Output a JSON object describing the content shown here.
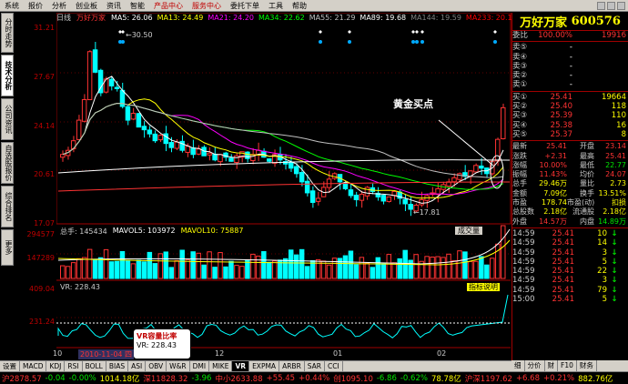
{
  "menubar": {
    "items": [
      "系统",
      "报价",
      "分析",
      "创业板",
      "资讯",
      "智能",
      "产品中心",
      "服务中心",
      "委托下单",
      "工具",
      "帮助"
    ],
    "highlight": [
      false,
      false,
      false,
      false,
      false,
      false,
      true,
      true,
      false,
      false,
      false
    ]
  },
  "left_tabs": [
    "分时走势",
    "技术分析",
    "公司资讯",
    "自选股报价",
    "综合排名",
    "更多"
  ],
  "active_left_tab": "技术分析",
  "kline": {
    "period": "日线",
    "stock": "万好万家",
    "ma_labels": [
      {
        "text": "MA5: 26.06",
        "color": "#ffffff"
      },
      {
        "text": "MA13: 24.49",
        "color": "#ffff00"
      },
      {
        "text": "MA21: 24.20",
        "color": "#ff00ff"
      },
      {
        "text": "MA34: 22.62",
        "color": "#00ff00"
      },
      {
        "text": "MA55: 21.29",
        "color": "#c0c0c0"
      },
      {
        "text": "MA89: 19.68",
        "color": "#ffffff"
      },
      {
        "text": "MA144: 19.59",
        "color": "#808080"
      },
      {
        "text": "MA233: 20.14",
        "color": "#ff0000"
      }
    ],
    "price_axis": [
      "31.21",
      "27.67",
      "24.14",
      "20.61",
      "17.07"
    ],
    "high_label": "30.50",
    "low_label": "17.81",
    "annotation": "黄金买点"
  },
  "volume": {
    "total_label": "总手: 145434",
    "mavol5_label": "MAVOL5: 103972",
    "mavol10_label": "MAVOL10: 75887",
    "axis": [
      "294577",
      "147289"
    ],
    "badge": "成交量"
  },
  "vr": {
    "label": "VR: 228.43",
    "axis": [
      "409.04",
      "231.24"
    ],
    "badge": "指标说明"
  },
  "date_axis": {
    "labels": [
      "10",
      "2010-11-04 四",
      "12",
      "01",
      "02"
    ]
  },
  "tooltip": {
    "title": "VR容量比率",
    "value": "VR: 228.43"
  },
  "quote": {
    "name": "万好万家",
    "code": "600576",
    "weibi_label": "委比",
    "weibi_value": "100.00%",
    "weicha_value": "19916",
    "sell": [
      {
        "label": "卖⑤",
        "price": "-",
        "vol": ""
      },
      {
        "label": "卖④",
        "price": "-",
        "vol": ""
      },
      {
        "label": "卖③",
        "price": "-",
        "vol": ""
      },
      {
        "label": "卖②",
        "price": "-",
        "vol": ""
      },
      {
        "label": "卖①",
        "price": "-",
        "vol": ""
      }
    ],
    "buy": [
      {
        "label": "买①",
        "price": "25.41",
        "vol": "19664"
      },
      {
        "label": "买②",
        "price": "25.40",
        "vol": "118"
      },
      {
        "label": "买③",
        "price": "25.39",
        "vol": "110"
      },
      {
        "label": "买④",
        "price": "25.38",
        "vol": "16"
      },
      {
        "label": "买⑤",
        "price": "25.37",
        "vol": "8"
      }
    ],
    "stats": [
      {
        "l1": "最新",
        "v1": "25.41",
        "l2": "开盘",
        "v2": "23.14"
      },
      {
        "l1": "涨跌",
        "v1": "+2.31",
        "l2": "最高",
        "v2": "25.41"
      },
      {
        "l1": "涨幅",
        "v1": "10.00%",
        "l2": "最低",
        "v2": "22.77"
      },
      {
        "l1": "振幅",
        "v1": "11.43%",
        "l2": "均价",
        "v2": "24.07"
      },
      {
        "l1": "总手",
        "v1": "29.46万",
        "l2": "量比",
        "v2": "2.73"
      },
      {
        "l1": "金额",
        "v1": "7.09亿",
        "l2": "换手",
        "v2": "13.51%"
      },
      {
        "l1": "市盈",
        "v1": "178.74",
        "l2": "市盈(动)",
        "v2": "扣损"
      },
      {
        "l1": "总股数",
        "v1": "2.18亿",
        "l2": "流通股",
        "v2": "2.18亿"
      },
      {
        "l1": "外盘",
        "v1": "14.57万",
        "l2": "内盘",
        "v2": "14.89万"
      }
    ],
    "ticks": [
      {
        "time": "14:59",
        "price": "25.41",
        "vol": "10",
        "dir": "down"
      },
      {
        "time": "14:59",
        "price": "25.41",
        "vol": "14",
        "dir": "down"
      },
      {
        "time": "14:59",
        "price": "25.41",
        "vol": "3",
        "dir": "down"
      },
      {
        "time": "14:59",
        "price": "25.41",
        "vol": "5",
        "dir": "down"
      },
      {
        "time": "14:59",
        "price": "25.41",
        "vol": "22",
        "dir": "down"
      },
      {
        "time": "14:59",
        "price": "25.41",
        "vol": "3",
        "dir": "down"
      },
      {
        "time": "14:59",
        "price": "25.41",
        "vol": "79",
        "dir": "down"
      },
      {
        "time": "15:00",
        "price": "25.41",
        "vol": "5",
        "dir": "down"
      }
    ]
  },
  "bottom_tabs": [
    "设置",
    "MACD",
    "KDJ",
    "RSI",
    "BOLL",
    "BIAS",
    "ASI",
    "OBV",
    "W&R",
    "DMI",
    "MIKE",
    "VR",
    "EXPMA",
    "ARBR",
    "SAR",
    "CCI"
  ],
  "active_bottom_tab": "VR",
  "right_tabs": [
    "细",
    "分价",
    "财",
    "F10",
    "财务"
  ],
  "status_bar": [
    {
      "text": "沪2878.57",
      "color": "#ff3333"
    },
    {
      "text": "-0.04",
      "color": "#00e600"
    },
    {
      "text": "-0.00%",
      "color": "#00e600"
    },
    {
      "text": "1014.18亿",
      "color": "#ffff00"
    },
    {
      "text": "深11828.32",
      "color": "#ff3333"
    },
    {
      "text": "-3.96",
      "color": "#00e600"
    },
    {
      "text": "中小2633.88",
      "color": "#ff3333"
    },
    {
      "text": "+55.45",
      "color": "#ff3333"
    },
    {
      "text": "+0.44%",
      "color": "#ff3333"
    },
    {
      "text": "创1095.10",
      "color": "#ff3333"
    },
    {
      "text": "-6.86",
      "color": "#00e600"
    },
    {
      "text": "-0.62%",
      "color": "#00e600"
    },
    {
      "text": "78.78亿",
      "color": "#ffff00"
    },
    {
      "text": "沪深1197.62",
      "color": "#ff3333"
    },
    {
      "text": "+6.68",
      "color": "#ff3333"
    },
    {
      "text": "+0.21%",
      "color": "#ff3333"
    },
    {
      "text": "882.76亿",
      "color": "#ffff00"
    }
  ]
}
